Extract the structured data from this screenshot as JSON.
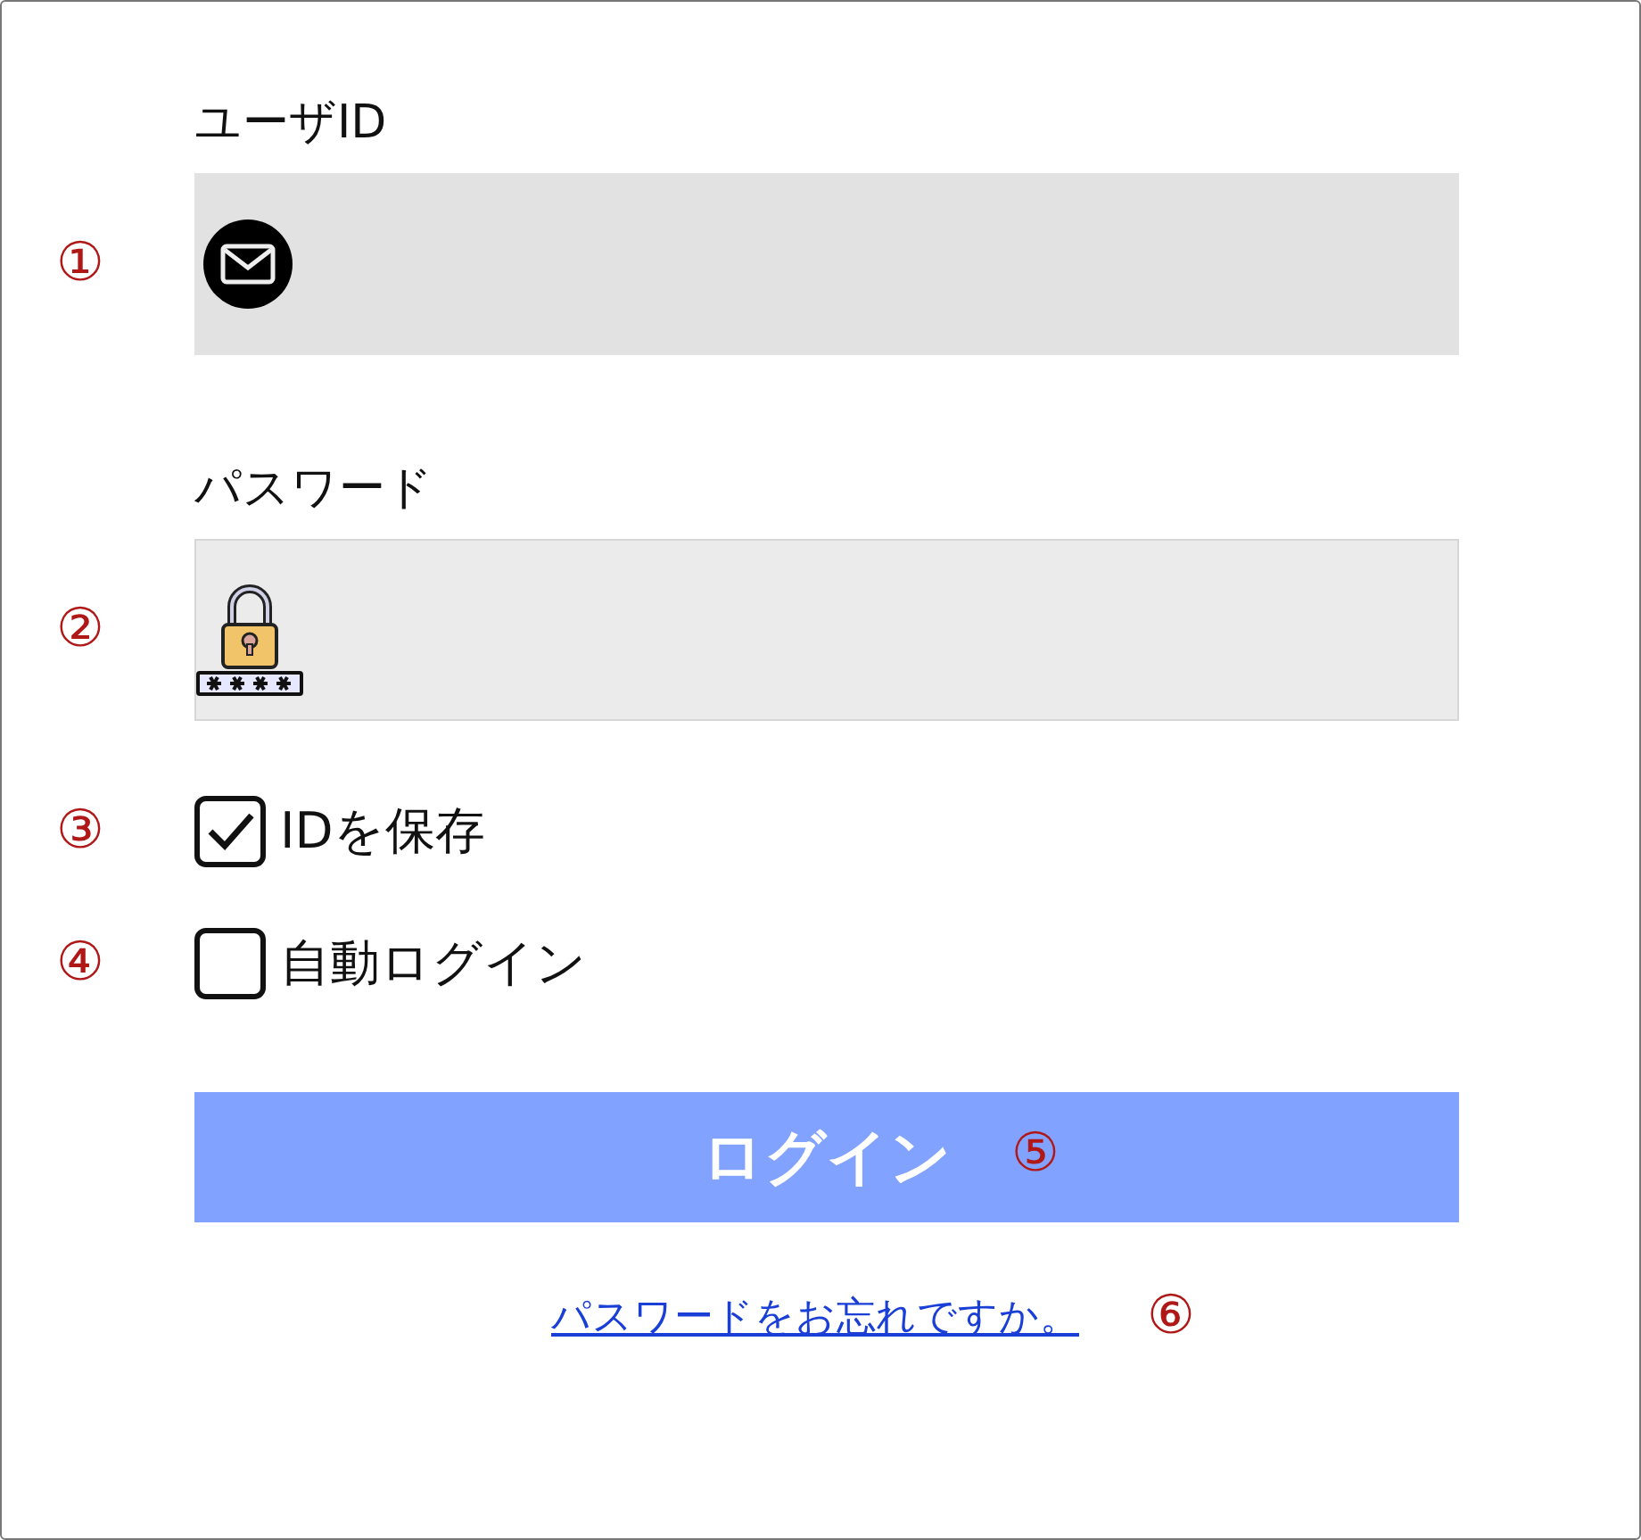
{
  "fields": [
    {
      "kind": "email",
      "label": "ユーザID",
      "marker": "①"
    },
    {
      "kind": "password",
      "label": "パスワード",
      "marker": "②"
    }
  ],
  "options": [
    {
      "label": "IDを保存",
      "checked": true,
      "marker": "③"
    },
    {
      "label": "自動ログイン",
      "checked": false,
      "marker": "④"
    }
  ],
  "login_button": {
    "label": "ログイン",
    "marker": "⑤"
  },
  "forgot_link": {
    "label": "パスワードをお忘れですか。",
    "marker": "⑥"
  }
}
